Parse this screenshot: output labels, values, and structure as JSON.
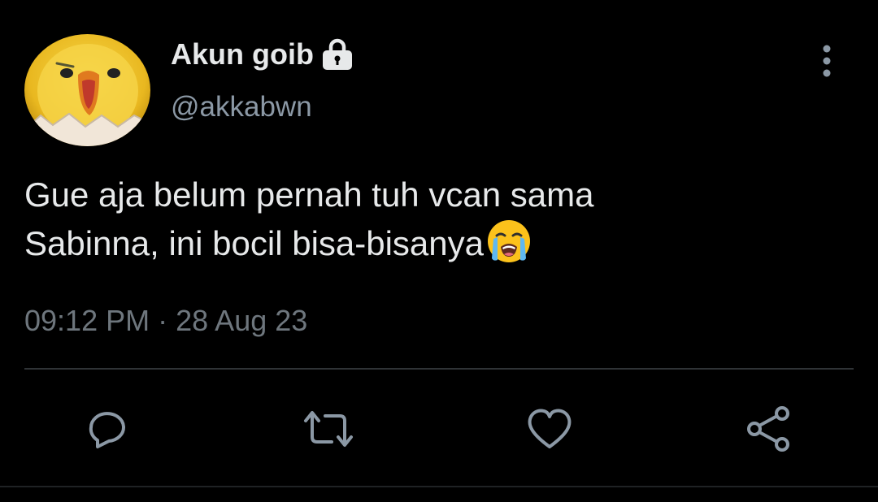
{
  "tweet": {
    "display_name": "Akun goib",
    "handle": "@akkabwn",
    "text_line1": "Gue aja belum pernah tuh vcan sama",
    "text_line2": "Sabinna, ini bocil bisa-bisanya",
    "emoji": "loudly-crying-face",
    "time": "09:12 PM",
    "separator": "·",
    "date": "28 Aug 23",
    "protected": true
  },
  "icons": {
    "lock": "lock-icon",
    "more": "more-vertical-icon",
    "reply": "reply-icon",
    "retweet": "retweet-icon",
    "like": "heart-icon",
    "share": "share-icon"
  },
  "colors": {
    "background": "#000000",
    "primary_text": "#e7e9ea",
    "secondary_text": "#8b98a5",
    "meta_text": "#6e767d",
    "action_icon": "#8b98a5",
    "divider": "#2f3336"
  }
}
